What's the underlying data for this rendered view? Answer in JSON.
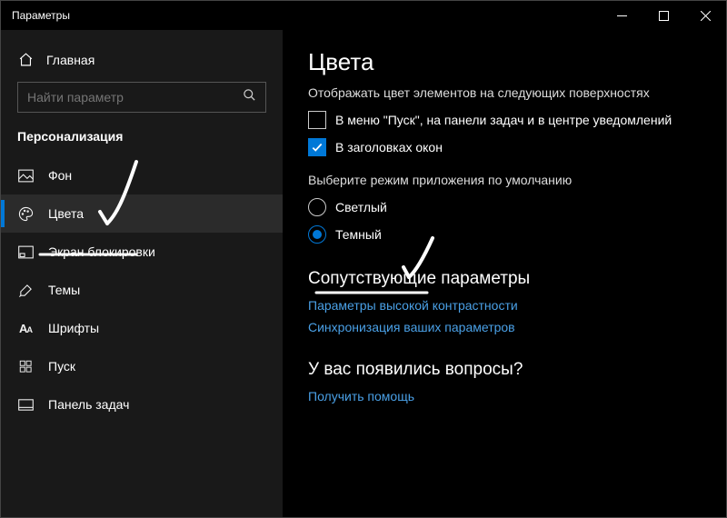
{
  "titlebar": {
    "title": "Параметры"
  },
  "sidebar": {
    "home_label": "Главная",
    "search_placeholder": "Найти параметр",
    "section_title": "Персонализация",
    "items": [
      {
        "label": "Фон"
      },
      {
        "label": "Цвета"
      },
      {
        "label": "Экран блокировки"
      },
      {
        "label": "Темы"
      },
      {
        "label": "Шрифты"
      },
      {
        "label": "Пуск"
      },
      {
        "label": "Панель задач"
      }
    ]
  },
  "main": {
    "page_title": "Цвета",
    "accent_surfaces_label": "Отображать цвет элементов на следующих поверхностях",
    "check_start": "В меню \"Пуск\", на панели задач и в центре уведомлений",
    "check_titlebars": "В заголовках окон",
    "app_mode_label": "Выберите режим приложения по умолчанию",
    "radio_light": "Светлый",
    "radio_dark": "Темный",
    "related_heading": "Сопутствующие параметры",
    "link_high_contrast": "Параметры высокой контрастности",
    "link_sync": "Синхронизация ваших параметров",
    "questions_heading": "У вас появились вопросы?",
    "link_help": "Получить помощь"
  }
}
